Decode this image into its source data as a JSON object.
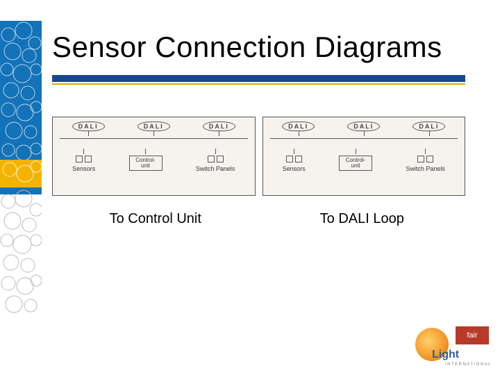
{
  "title": "Sensor Connection Diagrams",
  "accent": {
    "primary": "#17498f",
    "secondary": "#e3a500"
  },
  "deco": {
    "blue_fill": "#1372b8",
    "yellow_fill": "#f3b300"
  },
  "diagrams": [
    {
      "caption": "To Control Unit",
      "dali_label": "DALI",
      "control_line1": "Control-",
      "control_line2": "unit",
      "sensors_label": "Sensors",
      "switch_label": "Switch Panels"
    },
    {
      "caption": "To DALI Loop",
      "dali_label": "DALI",
      "control_line1": "Control-",
      "control_line2": "unit",
      "sensors_label": "Sensors",
      "switch_label": "Switch Panels"
    }
  ],
  "logo": {
    "brand_top": "fair",
    "brand_main": "Light",
    "brand_sub": "INTERNATIONAL"
  }
}
